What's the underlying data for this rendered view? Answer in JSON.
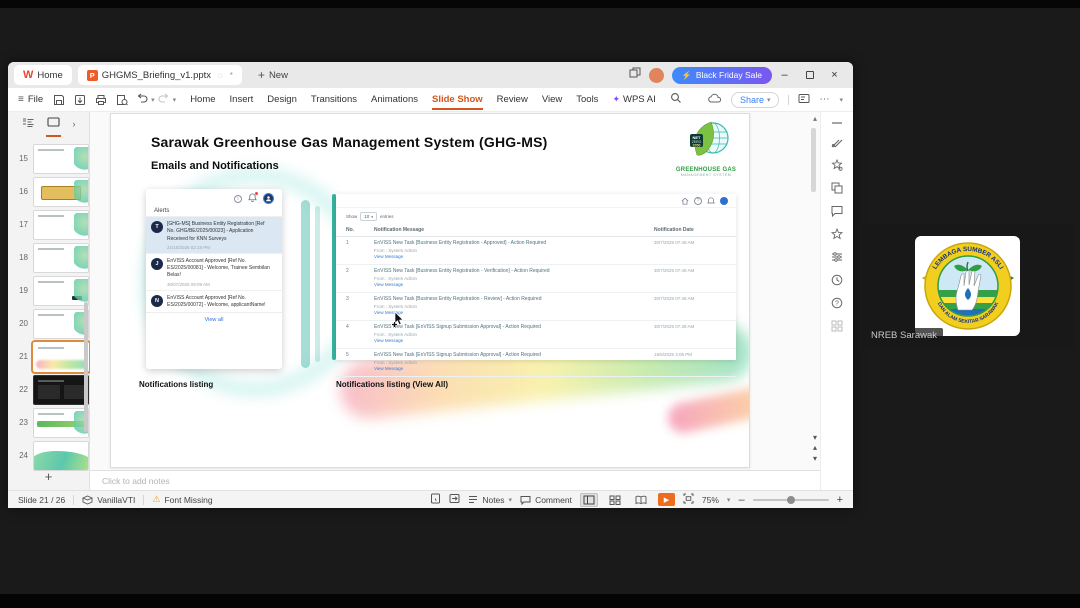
{
  "titlebar": {
    "home_tab": "Home",
    "document_tab": "GHGMS_Briefing_v1.pptx",
    "unsaved_marker": "*",
    "new_tab": "New",
    "promo": "Black Friday Sale"
  },
  "toolbar": {
    "file": "File",
    "menus": [
      "Home",
      "Insert",
      "Design",
      "Transitions",
      "Animations",
      "Slide Show",
      "Review",
      "View",
      "Tools"
    ],
    "wps_ai": "WPS AI",
    "share": "Share"
  },
  "slides_panel": {
    "numbers": [
      "15",
      "16",
      "17",
      "18",
      "19",
      "20",
      "21",
      "22",
      "23",
      "24"
    ],
    "selected": "21"
  },
  "slide": {
    "title": "Sarawak Greenhouse Gas Management System (GHG-MS)",
    "subtitle": "Emails and Notifications",
    "logo": {
      "badge_line1": "NET",
      "badge_line2": "ZERO",
      "badge_line3": "2050",
      "name_line1": "GREENHOUSE GAS",
      "name_line2": "MANAGEMENT SYSTEM"
    },
    "alerts": {
      "title": "Alerts",
      "items": [
        {
          "initial": "T",
          "text": "[GHG-MS] Business Entity Registration [Ref No. GHG/BE/2025/00023] - Application Received for KNN Surveys",
          "time": "21/10/2025 02:19 PM"
        },
        {
          "initial": "J",
          "text": "EnVISS Account Approved [Ref No. ES/2025/00081] - Welcome, Trainee Sembilan Belas!",
          "time": "30/07/2025 09:09 AM"
        },
        {
          "initial": "N",
          "text": "EnVISS Account Approved [Ref No. ES/2025/00072] - Welcome, applicantName!",
          "time": ""
        }
      ],
      "view_all": "View all"
    },
    "table": {
      "show": "Show",
      "page_size": "10",
      "entries": "entries",
      "headers": {
        "no": "No.",
        "message": "Notification Message",
        "date": "Notification Date"
      },
      "rows": [
        {
          "no": "1",
          "message": "EnVISS New Task [Business Entity Registration - Approved] - Action Required",
          "from": "From : System Admin",
          "link": "View Message",
          "date": "30/7/2025 07:49 AM"
        },
        {
          "no": "2",
          "message": "EnVISS New Task [Business Entity Registration - Verification] - Action Required",
          "from": "From : System Admin",
          "link": "View Message",
          "date": "30/7/2025 07:49 AM"
        },
        {
          "no": "3",
          "message": "EnVISS New Task [Business Entity Registration - Review] - Action Required",
          "from": "From : System Admin",
          "link": "View Message",
          "date": "30/7/2025 07:46 AM"
        },
        {
          "no": "4",
          "message": "EnVISS New Task [EnVISS Signup Submission Approval] - Action Required",
          "from": "From : System Admin",
          "link": "View Message",
          "date": "30/7/2025 07:39 AM"
        },
        {
          "no": "5",
          "message": "EnVISS New Task [EnVISS Signup Submission Approval] - Action Required",
          "from": "From : System Admin",
          "link": "View Message",
          "date": "18/6/2025 3:06 PM"
        }
      ]
    },
    "captions": {
      "left": "Notifications listing",
      "right": "Notifications listing (View All)"
    }
  },
  "notes": {
    "placeholder": "Click to add notes"
  },
  "statusbar": {
    "slide_indicator": "Slide 21 / 26",
    "theme_name": "VanillaVTI",
    "font_warning": "Font Missing",
    "notes_label": "Notes",
    "comment_label": "Comment",
    "zoom_level": "75%"
  },
  "meeting": {
    "participant_name": "NREB Sarawak",
    "logo_arc_top": "LEMBAGA SUMBER ASLI",
    "logo_arc_bottom": "DAN ALAM SEKITAR SARAWAK"
  }
}
